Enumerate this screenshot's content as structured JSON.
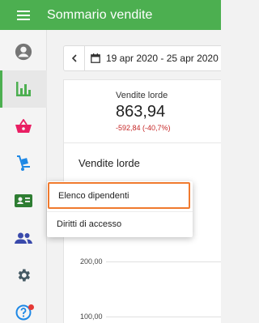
{
  "app": {
    "title": "Sommario vendite"
  },
  "toolbar": {
    "date_range": "19 apr 2020 - 25 apr 2020"
  },
  "kpi": {
    "label": "Vendite lorde",
    "value": "863,94",
    "delta": "-592,84 (-40,7%)"
  },
  "chart": {
    "title": "Vendite lorde",
    "y_ticks": [
      "200,00",
      "100,00"
    ]
  },
  "dropdown": {
    "items": [
      "Elenco dipendenti",
      "Diritti di accesso"
    ]
  },
  "nav": {
    "items": [
      "account",
      "reports",
      "sales",
      "shipping",
      "employees",
      "customers",
      "settings",
      "help"
    ]
  },
  "colors": {
    "accent": "#4caf50",
    "highlight": "#f07a2e",
    "negative": "#c62828",
    "badge": "#e53935"
  }
}
